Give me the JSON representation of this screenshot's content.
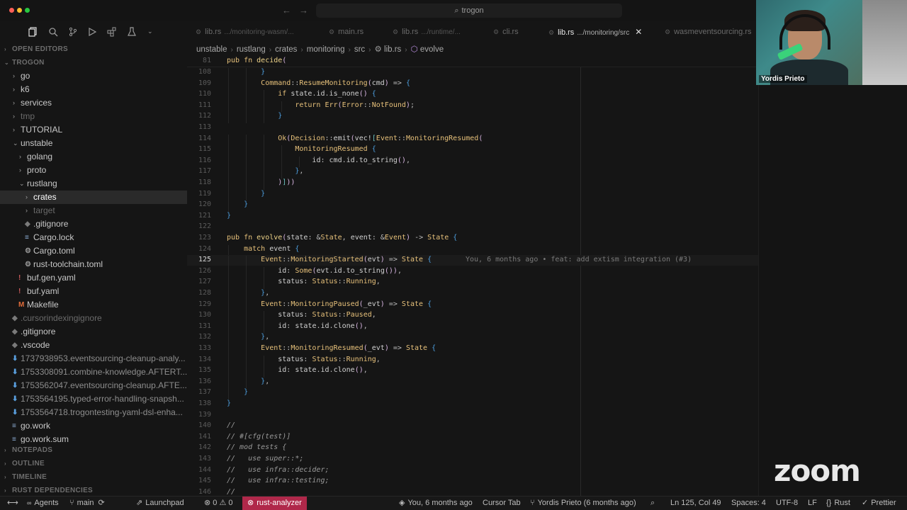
{
  "window": {
    "title": "trogon"
  },
  "activity_icons": [
    "explorer-icon",
    "search-icon",
    "source-control-icon",
    "run-debug-icon",
    "extensions-icon",
    "testing-icon",
    "chevron-down-icon"
  ],
  "sidebar": {
    "open_editors": "OPEN EDITORS",
    "project": "TROGON",
    "items": [
      {
        "label": "go",
        "depth": 1,
        "kind": "folder",
        "open": false
      },
      {
        "label": "k6",
        "depth": 1,
        "kind": "folder",
        "open": false
      },
      {
        "label": "services",
        "depth": 1,
        "kind": "folder",
        "open": false
      },
      {
        "label": "tmp",
        "depth": 1,
        "kind": "folder",
        "open": false,
        "dim": true
      },
      {
        "label": "TUTORIAL",
        "depth": 1,
        "kind": "folder",
        "open": false
      },
      {
        "label": "unstable",
        "depth": 1,
        "kind": "folder",
        "open": true
      },
      {
        "label": "golang",
        "depth": 2,
        "kind": "folder",
        "open": false
      },
      {
        "label": "proto",
        "depth": 2,
        "kind": "folder",
        "open": false
      },
      {
        "label": "rustlang",
        "depth": 2,
        "kind": "folder",
        "open": true
      },
      {
        "label": "crates",
        "depth": 3,
        "kind": "folder",
        "open": false,
        "selected": true
      },
      {
        "label": "target",
        "depth": 3,
        "kind": "folder",
        "open": false,
        "dim": true
      },
      {
        "label": ".gitignore",
        "depth": 3,
        "kind": "file",
        "icon": "◆"
      },
      {
        "label": "Cargo.lock",
        "depth": 3,
        "kind": "file",
        "icon": "≡"
      },
      {
        "label": "Cargo.toml",
        "depth": 3,
        "kind": "file",
        "icon": "⚙"
      },
      {
        "label": "rust-toolchain.toml",
        "depth": 3,
        "kind": "file",
        "icon": "⚙"
      },
      {
        "label": "buf.gen.yaml",
        "depth": 2,
        "kind": "file",
        "icon": "!"
      },
      {
        "label": "buf.yaml",
        "depth": 2,
        "kind": "file",
        "icon": "!"
      },
      {
        "label": "Makefile",
        "depth": 2,
        "kind": "file",
        "icon": "M"
      },
      {
        "label": ".cursorindexingignore",
        "depth": 1,
        "kind": "file",
        "icon": "◆",
        "dim": true
      },
      {
        "label": ".gitignore",
        "depth": 1,
        "kind": "file",
        "icon": "◆"
      },
      {
        "label": ".vscode",
        "depth": 1,
        "kind": "file",
        "icon": "◆"
      },
      {
        "label": "1737938953.eventsourcing-cleanup-analy...",
        "depth": 1,
        "kind": "file",
        "icon": "⬇",
        "git": true
      },
      {
        "label": "1753308091.combine-knowledge.AFTERT...",
        "depth": 1,
        "kind": "file",
        "icon": "⬇",
        "git": true
      },
      {
        "label": "1753562047.eventsourcing-cleanup.AFTE...",
        "depth": 1,
        "kind": "file",
        "icon": "⬇",
        "git": true
      },
      {
        "label": "1753564195.typed-error-handling-snapsh...",
        "depth": 1,
        "kind": "file",
        "icon": "⬇",
        "git": true
      },
      {
        "label": "1753564718.trogontesting-yaml-dsl-enha...",
        "depth": 1,
        "kind": "file",
        "icon": "⬇",
        "git": true
      },
      {
        "label": "go.work",
        "depth": 1,
        "kind": "file",
        "icon": "≡"
      },
      {
        "label": "go.work.sum",
        "depth": 1,
        "kind": "file",
        "icon": "≡"
      }
    ],
    "bottom_sections": [
      "NOTEPADS",
      "OUTLINE",
      "TIMELINE",
      "RUST DEPENDENCIES"
    ]
  },
  "tabs": [
    {
      "label": "lib.rs",
      "path": ".../monitoring-wasm/...",
      "active": false
    },
    {
      "label": "main.rs",
      "path": "",
      "active": false
    },
    {
      "label": "lib.rs",
      "path": ".../runtime/...",
      "active": false
    },
    {
      "label": "cli.rs",
      "path": "",
      "active": false
    },
    {
      "label": "lib.rs",
      "path": ".../monitoring/src",
      "active": true
    },
    {
      "label": "wasmeventsourcing.rs",
      "path": "",
      "active": false
    }
  ],
  "breadcrumb": [
    "unstable",
    "rustlang",
    "crates",
    "monitoring",
    "src",
    "lib.rs",
    "evolve"
  ],
  "editor": {
    "sticky": {
      "line": "81",
      "text": "pub fn decide("
    },
    "current_line": 125,
    "blame": "You, 6 months ago • feat: add extism integration (#3)",
    "lines": [
      {
        "n": "108",
        "indent": 2,
        "t": "}"
      },
      {
        "n": "109",
        "indent": 2,
        "t": "Command::ResumeMonitoring(cmd) => {"
      },
      {
        "n": "110",
        "indent": 3,
        "t": "if state.id.is_none() {"
      },
      {
        "n": "111",
        "indent": 4,
        "t": "return Err(Error::NotFound);"
      },
      {
        "n": "112",
        "indent": 3,
        "t": "}"
      },
      {
        "n": "113",
        "indent": 0,
        "t": ""
      },
      {
        "n": "114",
        "indent": 3,
        "t": "Ok(Decision::emit(vec![Event::MonitoringResumed("
      },
      {
        "n": "115",
        "indent": 4,
        "t": "MonitoringResumed {"
      },
      {
        "n": "116",
        "indent": 5,
        "t": "id: cmd.id.to_string(),"
      },
      {
        "n": "117",
        "indent": 4,
        "t": "},"
      },
      {
        "n": "118",
        "indent": 3,
        "t": ")]))"
      },
      {
        "n": "119",
        "indent": 2,
        "t": "}"
      },
      {
        "n": "120",
        "indent": 1,
        "t": "}"
      },
      {
        "n": "121",
        "indent": 0,
        "t": "}"
      },
      {
        "n": "122",
        "indent": 0,
        "t": ""
      },
      {
        "n": "123",
        "indent": 0,
        "t": "pub fn evolve(state: &State, event: &Event) -> State {"
      },
      {
        "n": "124",
        "indent": 1,
        "t": "match event {"
      },
      {
        "n": "125",
        "indent": 2,
        "t": "Event::MonitoringStarted(evt) => State {"
      },
      {
        "n": "126",
        "indent": 3,
        "t": "id: Some(evt.id.to_string()),"
      },
      {
        "n": "127",
        "indent": 3,
        "t": "status: Status::Running,"
      },
      {
        "n": "128",
        "indent": 2,
        "t": "},"
      },
      {
        "n": "129",
        "indent": 2,
        "t": "Event::MonitoringPaused(_evt) => State {"
      },
      {
        "n": "130",
        "indent": 3,
        "t": "status: Status::Paused,"
      },
      {
        "n": "131",
        "indent": 3,
        "t": "id: state.id.clone(),"
      },
      {
        "n": "132",
        "indent": 2,
        "t": "},"
      },
      {
        "n": "133",
        "indent": 2,
        "t": "Event::MonitoringResumed(_evt) => State {"
      },
      {
        "n": "134",
        "indent": 3,
        "t": "status: Status::Running,"
      },
      {
        "n": "135",
        "indent": 3,
        "t": "id: state.id.clone(),"
      },
      {
        "n": "136",
        "indent": 2,
        "t": "},"
      },
      {
        "n": "137",
        "indent": 1,
        "t": "}"
      },
      {
        "n": "138",
        "indent": 0,
        "t": "}"
      },
      {
        "n": "139",
        "indent": 0,
        "t": ""
      },
      {
        "n": "140",
        "indent": 0,
        "t": "//",
        "comment": true
      },
      {
        "n": "141",
        "indent": 0,
        "t": "// #[cfg(test)]",
        "comment": true
      },
      {
        "n": "142",
        "indent": 0,
        "t": "// mod tests {",
        "comment": true
      },
      {
        "n": "143",
        "indent": 0,
        "t": "//   use super::*;",
        "comment": true
      },
      {
        "n": "144",
        "indent": 0,
        "t": "//   use infra::decider;",
        "comment": true
      },
      {
        "n": "145",
        "indent": 0,
        "t": "//   use infra::testing;",
        "comment": true
      },
      {
        "n": "146",
        "indent": 0,
        "t": "//",
        "comment": true
      }
    ]
  },
  "webcam": {
    "name": "Yordis Prieto"
  },
  "zoom_logo": "zoom",
  "statusbar": {
    "agents": "Agents",
    "branch": "main",
    "launchpad": "Launchpad",
    "errors": "0",
    "warnings": "0",
    "rust_analyzer": "rust-analyzer",
    "blame": "You, 6 months ago",
    "cursor_tab": "Cursor Tab",
    "author": "Yordis Prieto (6 months ago)",
    "position": "Ln 125, Col 49",
    "spaces": "Spaces: 4",
    "encoding": "UTF-8",
    "eol": "LF",
    "language": "Rust",
    "formatter": "Prettier"
  },
  "colors": {
    "accent_error": "#b0284a",
    "background": "#151515",
    "sidebar_selection": "#2a2a2a"
  }
}
